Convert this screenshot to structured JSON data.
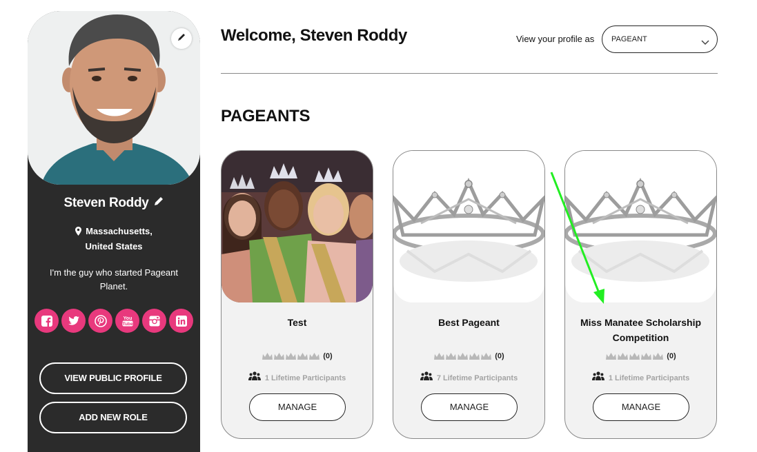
{
  "profile": {
    "name": "Steven Roddy",
    "location_line1": "Massachusetts,",
    "location_line2": "United States",
    "bio": "I'm the guy who started Pageant Planet.",
    "socials": [
      "facebook-icon",
      "twitter-icon",
      "pinterest-icon",
      "youtube-icon",
      "instagram-icon",
      "linkedin-icon"
    ],
    "accent_color": "#e8397d",
    "view_public_profile_label": "VIEW PUBLIC PROFILE",
    "add_new_role_label": "ADD NEW ROLE"
  },
  "header": {
    "welcome": "Welcome, Steven Roddy",
    "view_as_label": "View your profile as",
    "view_as_value": "PAGEANT"
  },
  "section_title": "PAGEANTS",
  "pageants": [
    {
      "title": "Test",
      "rating_count": "(0)",
      "participants": "1 Lifetime Participants",
      "manage_label": "MANAGE",
      "image": "pageant-contestants-photo"
    },
    {
      "title": "Best Pageant",
      "rating_count": "(0)",
      "participants": "7 Lifetime Participants",
      "manage_label": "MANAGE",
      "image": "crown-photo"
    },
    {
      "title": "Miss Manatee Scholarship Competition",
      "rating_count": "(0)",
      "participants": "1 Lifetime Participants",
      "manage_label": "MANAGE",
      "image": "crown-photo"
    }
  ],
  "annotation": {
    "color": "#22ee22"
  }
}
